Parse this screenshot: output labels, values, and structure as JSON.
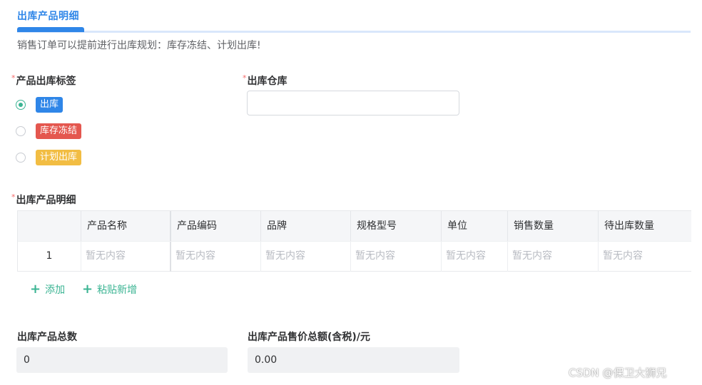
{
  "header": {
    "tab_title": "出库产品明细",
    "notice": "销售订单可以提前进行出库规划：库存冻结、计划出库!"
  },
  "form": {
    "required_mark": "*",
    "tags_label": "产品出库标签",
    "warehouse_label": "出库仓库",
    "warehouse_value": "",
    "tags": [
      {
        "label": "出库",
        "checked": true,
        "color": "#2f86e8"
      },
      {
        "label": "库存冻结",
        "checked": false,
        "color": "#e4574f"
      },
      {
        "label": "计划出库",
        "checked": false,
        "color": "#f2bd43"
      }
    ]
  },
  "detail": {
    "label": "出库产品明细",
    "columns": [
      "产品名称",
      "产品编码",
      "品牌",
      "规格型号",
      "单位",
      "销售数量",
      "待出库数量"
    ],
    "rows": [
      {
        "index": "1",
        "cells": [
          "暂无内容",
          "暂无内容",
          "暂无内容",
          "暂无内容",
          "暂无内容",
          "暂无内容",
          "暂无内容"
        ]
      }
    ],
    "add_label": "添加",
    "paste_label": "粘贴新增"
  },
  "totals": {
    "count_label": "出库产品总数",
    "count_value": "0",
    "amount_label": "出库产品售价总额(含税)/元",
    "amount_value": "0.00"
  },
  "watermark": "CSDN @保卫大狮兄",
  "colors": {
    "accent": "#2f86e8",
    "success": "#3bb493",
    "required": "#f56c6c"
  }
}
